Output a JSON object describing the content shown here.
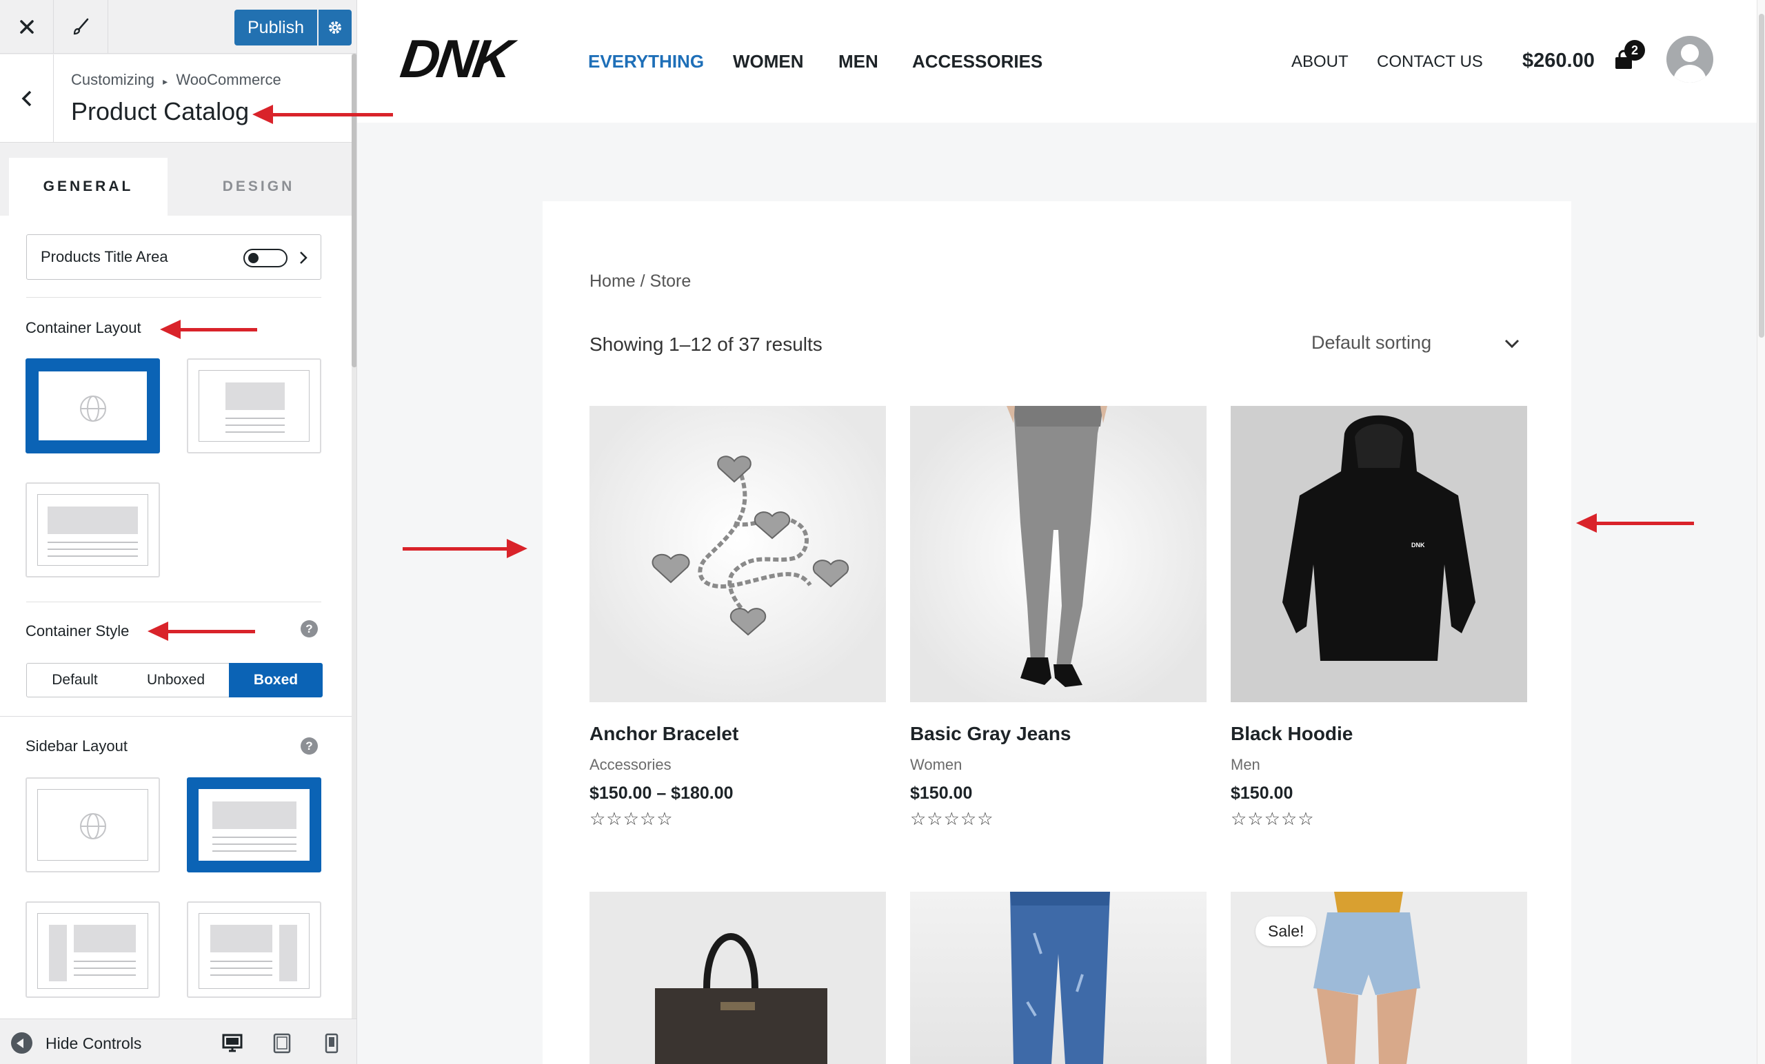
{
  "customizer": {
    "close_icon": "close-icon",
    "brush_icon": "paintbrush-icon",
    "publish_label": "Publish",
    "breadcrumb_root": "Customizing",
    "breadcrumb_sep": "▸",
    "breadcrumb_section": "WooCommerce",
    "panel_title": "Product Catalog",
    "tabs": [
      {
        "label": "GENERAL",
        "active": true
      },
      {
        "label": "DESIGN",
        "active": false
      }
    ],
    "products_title_area": {
      "label": "Products Title Area",
      "enabled": false
    },
    "container_layout": {
      "label": "Container Layout",
      "selected_index": 0
    },
    "container_style": {
      "label": "Container Style",
      "options": [
        "Default",
        "Unboxed",
        "Boxed"
      ],
      "selected": "Boxed",
      "help": "?"
    },
    "sidebar_layout": {
      "label": "Sidebar Layout",
      "selected_index": 1,
      "help": "?"
    },
    "footer": {
      "hide_controls": "Hide Controls"
    }
  },
  "site": {
    "logo": "DNK",
    "nav": [
      {
        "label": "EVERYTHING",
        "active": true
      },
      {
        "label": "WOMEN",
        "active": false
      },
      {
        "label": "MEN",
        "active": false
      },
      {
        "label": "ACCESSORIES",
        "active": false
      }
    ],
    "nav_right": [
      "ABOUT",
      "CONTACT US"
    ],
    "cart_total": "$260.00",
    "cart_count": "2",
    "breadcrumb": "Home / Store",
    "results": "Showing 1–12 of 37 results",
    "sorting": "Default sorting",
    "products": [
      {
        "name": "Anchor Bracelet",
        "category": "Accessories",
        "price": "$150.00 – $180.00",
        "rating": "☆☆☆☆☆"
      },
      {
        "name": "Basic Gray Jeans",
        "category": "Women",
        "price": "$150.00",
        "rating": "☆☆☆☆☆"
      },
      {
        "name": "Black Hoodie",
        "category": "Men",
        "price": "$150.00",
        "rating": "☆☆☆☆☆"
      }
    ],
    "sale_badge": "Sale!",
    "hoodie_print": "DNK"
  },
  "colors": {
    "accent": "#0b63b5",
    "annotation_arrow": "#d9232a"
  }
}
